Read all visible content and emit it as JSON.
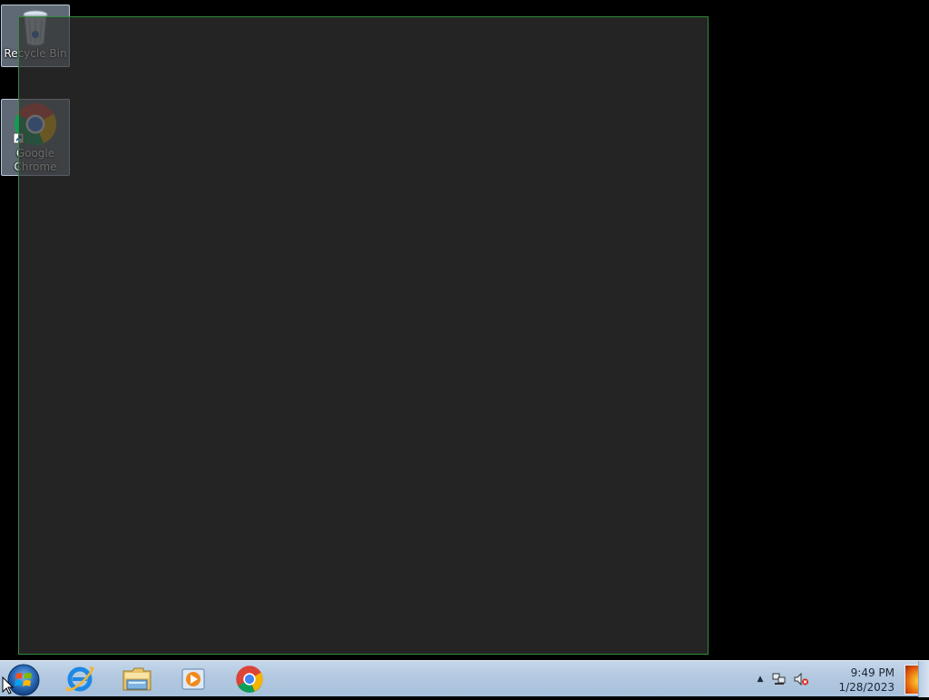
{
  "desktop": {
    "icons": [
      {
        "label": "Recycle Bin",
        "icon": "recycle-bin-icon"
      },
      {
        "label": "Google Chrome",
        "icon": "chrome-icon"
      }
    ]
  },
  "taskbar": {
    "start": {
      "icon": "windows-start-orb-icon"
    },
    "pinned": [
      {
        "icon": "internet-explorer-icon"
      },
      {
        "icon": "windows-explorer-icon"
      },
      {
        "icon": "windows-media-player-icon"
      },
      {
        "icon": "chrome-icon"
      }
    ],
    "tray": {
      "time": "9:49 PM",
      "date": "1/28/2023",
      "icons": [
        "show-hidden-icons-arrow",
        "network-icon",
        "volume-muted-icon"
      ]
    }
  },
  "colors": {
    "taskbar": "#b3c9e0",
    "selection_border": "#2f8a3a",
    "selection_fill": "#323232"
  }
}
